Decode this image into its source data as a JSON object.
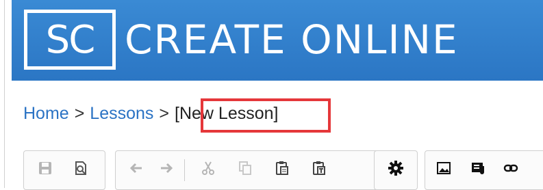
{
  "header": {
    "logo_text": "SC",
    "title": "CREATE ONLINE"
  },
  "breadcrumb": {
    "items": [
      "Home",
      "Lessons"
    ],
    "separator": ">",
    "current": "[New Lesson]"
  },
  "toolbar": {
    "groups": [
      {
        "name": "file",
        "icons": [
          "save-icon",
          "preview-icon"
        ]
      },
      {
        "name": "edit",
        "icons": [
          "undo-icon",
          "redo-icon",
          "cut-icon",
          "copy-icon",
          "paste-icon",
          "paste-text-icon"
        ]
      },
      {
        "name": "settings",
        "icons": [
          "gear-icon"
        ]
      },
      {
        "name": "insert",
        "icons": [
          "image-icon",
          "media-icon",
          "link-icon"
        ]
      }
    ]
  },
  "colors": {
    "header_bg": "#2f7fcc",
    "link": "#2b73c4",
    "highlight": "#e5373a",
    "icon_disabled": "#b5b5b5",
    "icon_active": "#333333"
  }
}
